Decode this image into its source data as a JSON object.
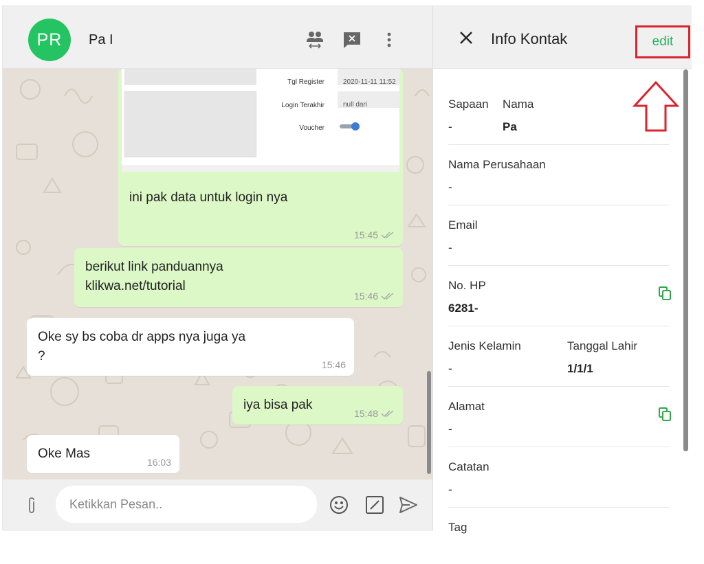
{
  "chat": {
    "avatar_initials": "PR",
    "contact_name": "Pa I",
    "header_icons": [
      "group-transfer-icon",
      "chat-close-icon",
      "more-vert-icon"
    ],
    "screenshot_form": {
      "tgl_register_label": "Tgl Register",
      "tgl_register_value": "2020-11-11 11:52",
      "login_terakhir_label": "Login Terakhir",
      "login_terakhir_value": "null dari",
      "voucher_label": "Voucher"
    },
    "messages": [
      {
        "direction": "out",
        "text": "ini pak data untuk login nya",
        "time": "15:45"
      },
      {
        "direction": "out",
        "text_line1": "berikut link panduannya",
        "text_line2": "klikwa.net/tutorial",
        "time": "15:46"
      },
      {
        "direction": "in",
        "text_line1": "Oke sy bs coba dr apps nya juga ya",
        "text_line2": "?",
        "time": "15:46"
      },
      {
        "direction": "out",
        "text": "iya bisa pak",
        "time": "15:48"
      },
      {
        "direction": "in",
        "text": "Oke Mas",
        "time": "16:03"
      }
    ],
    "composer": {
      "placeholder": "Ketikkan Pesan.."
    }
  },
  "info": {
    "title": "Info Kontak",
    "edit_label": "edit",
    "fields": {
      "sapaan": {
        "label": "Sapaan",
        "value": "-"
      },
      "nama": {
        "label": "Nama",
        "value": "Pa"
      },
      "nama_perusahaan": {
        "label": "Nama Perusahaan",
        "value": "-"
      },
      "email": {
        "label": "Email",
        "value": "-"
      },
      "no_hp": {
        "label": "No. HP",
        "value": "6281-"
      },
      "jenis_kelamin": {
        "label": "Jenis Kelamin",
        "value": "-"
      },
      "tanggal_lahir": {
        "label": "Tanggal Lahir",
        "value": "1/1/1"
      },
      "alamat": {
        "label": "Alamat",
        "value": "-"
      },
      "catatan": {
        "label": "Catatan",
        "value": "-"
      },
      "tag": {
        "label": "Tag"
      }
    }
  },
  "colors": {
    "accent_green": "#25c462",
    "outgoing_bubble": "#dcf8c6",
    "annotation_red": "#d9232d",
    "edit_text": "#25b25a"
  }
}
